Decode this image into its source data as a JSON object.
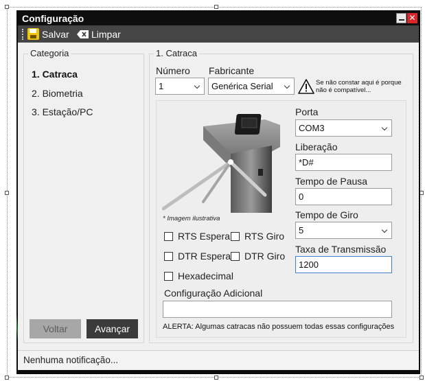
{
  "window": {
    "title": "Configuração",
    "close_glyph": "✕"
  },
  "toolbar": {
    "save_label": "Salvar",
    "clear_label": "Limpar",
    "save_icon": "floppy-disk-icon",
    "clear_icon": "backspace-icon"
  },
  "category": {
    "title": "Categoria",
    "items": [
      {
        "label": "1. Catraca",
        "active": true
      },
      {
        "label": "2. Biometria",
        "active": false
      },
      {
        "label": "3. Estação/PC",
        "active": false
      }
    ],
    "back_label": "Voltar",
    "next_label": "Avançar"
  },
  "catraca": {
    "title": "1. Catraca",
    "numero_label": "Número",
    "numero_value": "1",
    "fabricante_label": "Fabricante",
    "fabricante_value": "Genérica Serial",
    "warning_line1": "Se não constar aqui é porque",
    "warning_line2": "não é compatível...",
    "image_note": "* Imagem ilustrativa",
    "checkboxes": [
      {
        "label": "RTS Espera",
        "checked": false
      },
      {
        "label": "RTS Giro",
        "checked": false
      },
      {
        "label": "DTR Espera",
        "checked": false
      },
      {
        "label": "DTR Giro",
        "checked": false
      },
      {
        "label": "Hexadecimal",
        "checked": false
      }
    ],
    "porta_label": "Porta",
    "porta_value": "COM3",
    "liberacao_label": "Liberação",
    "liberacao_value": "*D#",
    "pausa_label": "Tempo de Pausa",
    "pausa_value": "0",
    "giro_label": "Tempo de Giro",
    "giro_value": "5",
    "taxa_label": "Taxa de Transmissão",
    "taxa_value": "1200",
    "config_label": "Configuração Adicional",
    "config_value": "",
    "alert": "ALERTA: Algumas catracas não possuem todas essas configurações"
  },
  "status": {
    "text": "Nenhuma notificação..."
  },
  "colors": {
    "toolbar": "#454545",
    "back_button": "#a7a7a7",
    "next_button": "#3b3b3b",
    "close_button": "#d8262a",
    "save_icon": "#f3c400"
  }
}
